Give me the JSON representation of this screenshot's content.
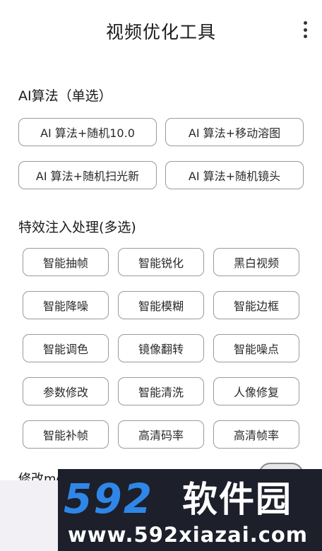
{
  "app_bar": {
    "title": "视频优化工具",
    "menu_icon": "more-vertical-icon"
  },
  "algorithm": {
    "title": "AI算法（单选）",
    "options": [
      "AI 算法+随机10.0",
      "AI 算法+移动溶图",
      "AI 算法+随机扫光新",
      "AI 算法+随机镜头"
    ]
  },
  "effects": {
    "title": "特效注入处理(多选)",
    "options": [
      "智能抽帧",
      "智能锐化",
      "黑白视频",
      "智能降噪",
      "智能模糊",
      "智能边框",
      "智能调色",
      "镜像翻转",
      "智能噪点",
      "参数修改",
      "智能清洗",
      "人像修复",
      "智能补帧",
      "高清码率",
      "高清帧率"
    ]
  },
  "bottom": {
    "label_partial": "修改md"
  },
  "watermark": {
    "logo": "592",
    "brand": "软件园",
    "url": "www.592xiazai.com"
  }
}
